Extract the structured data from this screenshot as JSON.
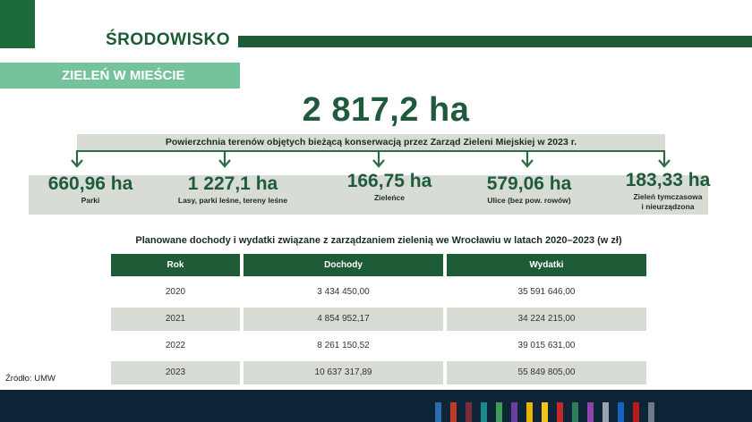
{
  "header": {
    "section_title": "ŚRODOWISKO",
    "subsection_title": "ZIELEŃ W MIEŚCIE"
  },
  "total": {
    "value": "2 817,2 ha",
    "description": "Powierzchnia terenów objętych bieżącą  konserwacją przez Zarząd Zieleni Miejskiej w 2023 r."
  },
  "categories": [
    {
      "value": "660,96 ha",
      "label": "Parki"
    },
    {
      "value": "1 227,1 ha",
      "label": "Lasy, parki leśne, tereny leśne"
    },
    {
      "value": "166,75 ha",
      "label": "Zieleńce"
    },
    {
      "value": "579,06 ha",
      "label": "Ulice (bez pow. rowów)"
    },
    {
      "value": "183,33 ha",
      "label": "Zieleń tymczasowa\ni nieurządzona"
    }
  ],
  "table": {
    "title": "Planowane dochody i wydatki związane z zarządzaniem zielenią we Wrocławiu w latach 2020–2023 (w zł)",
    "headers": [
      "Rok",
      "Dochody",
      "Wydatki"
    ],
    "rows": [
      [
        "2020",
        "3 434 450,00",
        "35 591 646,00"
      ],
      [
        "2021",
        "4 854 952,17",
        "34 224 215,00"
      ],
      [
        "2022",
        "8 261 150,52",
        "39 015 631,00"
      ],
      [
        "2023",
        "10 637 317,89",
        "55 849 805,00"
      ]
    ]
  },
  "source": "Źródło: UMW",
  "colors": {
    "dark_green": "#1e5c37",
    "light_green": "#74c39b",
    "band_gray": "#d7ddd4",
    "footer_navy": "#0e2437",
    "footer_stripes": [
      "#2b6cb0",
      "#c0392b",
      "#7b2d3b",
      "#1a8a8a",
      "#3d9b57",
      "#6b3fa0",
      "#e8b400",
      "#f0c419",
      "#c62828",
      "#2e7d5b",
      "#8e44ad",
      "#9aa3ad",
      "#1565c0",
      "#b71c1c",
      "#6d7b8a"
    ]
  }
}
